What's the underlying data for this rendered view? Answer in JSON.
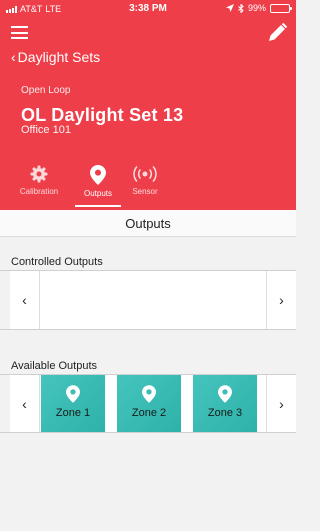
{
  "status_bar": {
    "carrier": "AT&T",
    "network": "LTE",
    "time": "3:38 PM",
    "battery_percent": "99%",
    "battery_level": 0.99
  },
  "header": {
    "back_label": "Daylight Sets",
    "mode": "Open Loop",
    "title": "OL Daylight Set 13",
    "location": "Office 101",
    "accent_color": "#ee3e49"
  },
  "tabs": [
    {
      "label": "Calibration",
      "icon": "gear-icon",
      "active": false
    },
    {
      "label": "Outputs",
      "icon": "location-pin-icon",
      "active": true
    },
    {
      "label": "Sensor",
      "icon": "broadcast-icon",
      "active": false
    }
  ],
  "section": {
    "title": "Outputs"
  },
  "controlled_outputs": {
    "label": "Controlled Outputs",
    "items": []
  },
  "available_outputs": {
    "label": "Available Outputs",
    "tile_color": "#3dbdb5",
    "items": [
      {
        "label": "Zone 1"
      },
      {
        "label": "Zone 2"
      },
      {
        "label": "Zone 3"
      }
    ]
  },
  "icons": {
    "prev": "‹",
    "next": "›",
    "back": "‹"
  }
}
